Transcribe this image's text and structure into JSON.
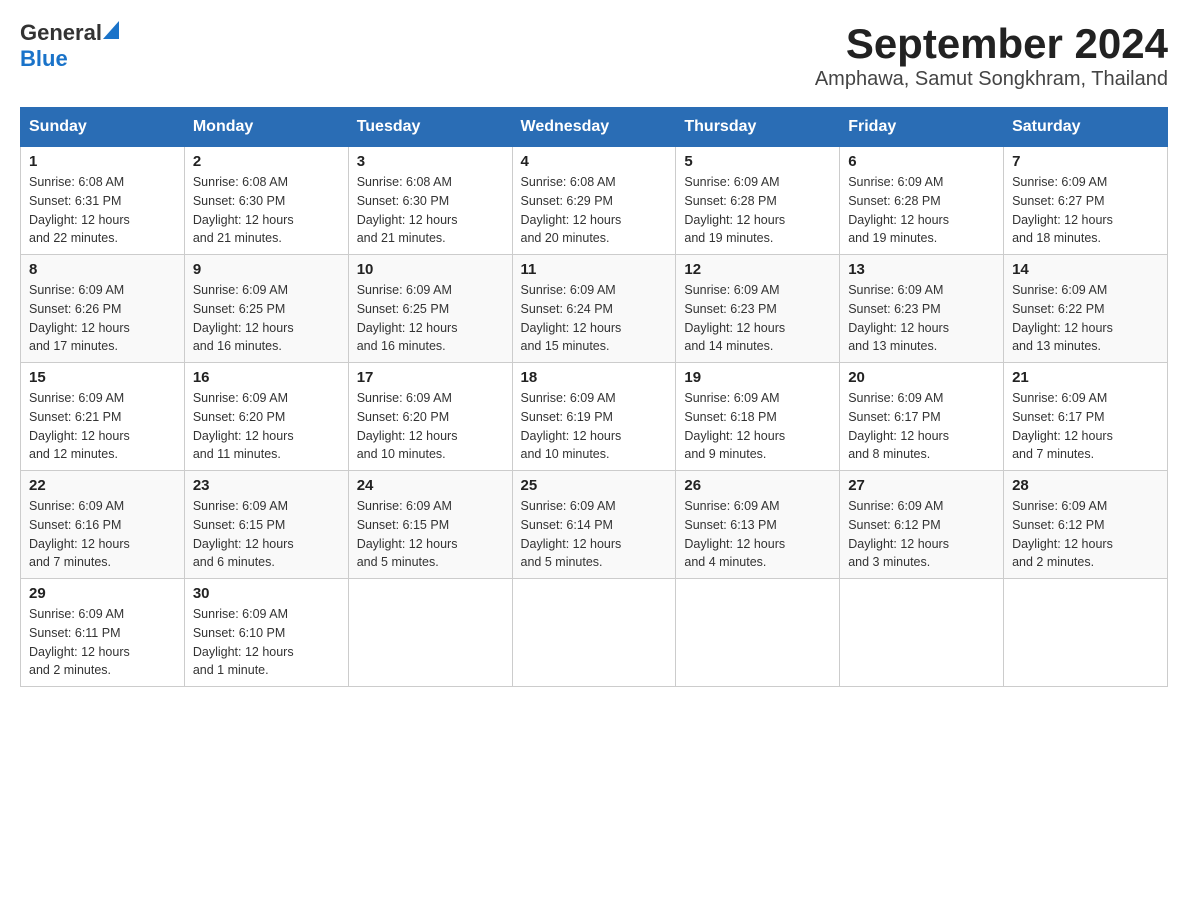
{
  "header": {
    "logo_general": "General",
    "logo_blue": "Blue",
    "month_year": "September 2024",
    "location": "Amphawa, Samut Songkhram, Thailand"
  },
  "weekdays": [
    "Sunday",
    "Monday",
    "Tuesday",
    "Wednesday",
    "Thursday",
    "Friday",
    "Saturday"
  ],
  "weeks": [
    [
      {
        "day": "1",
        "sunrise": "6:08 AM",
        "sunset": "6:31 PM",
        "daylight": "12 hours and 22 minutes."
      },
      {
        "day": "2",
        "sunrise": "6:08 AM",
        "sunset": "6:30 PM",
        "daylight": "12 hours and 21 minutes."
      },
      {
        "day": "3",
        "sunrise": "6:08 AM",
        "sunset": "6:30 PM",
        "daylight": "12 hours and 21 minutes."
      },
      {
        "day": "4",
        "sunrise": "6:08 AM",
        "sunset": "6:29 PM",
        "daylight": "12 hours and 20 minutes."
      },
      {
        "day": "5",
        "sunrise": "6:09 AM",
        "sunset": "6:28 PM",
        "daylight": "12 hours and 19 minutes."
      },
      {
        "day": "6",
        "sunrise": "6:09 AM",
        "sunset": "6:28 PM",
        "daylight": "12 hours and 19 minutes."
      },
      {
        "day": "7",
        "sunrise": "6:09 AM",
        "sunset": "6:27 PM",
        "daylight": "12 hours and 18 minutes."
      }
    ],
    [
      {
        "day": "8",
        "sunrise": "6:09 AM",
        "sunset": "6:26 PM",
        "daylight": "12 hours and 17 minutes."
      },
      {
        "day": "9",
        "sunrise": "6:09 AM",
        "sunset": "6:25 PM",
        "daylight": "12 hours and 16 minutes."
      },
      {
        "day": "10",
        "sunrise": "6:09 AM",
        "sunset": "6:25 PM",
        "daylight": "12 hours and 16 minutes."
      },
      {
        "day": "11",
        "sunrise": "6:09 AM",
        "sunset": "6:24 PM",
        "daylight": "12 hours and 15 minutes."
      },
      {
        "day": "12",
        "sunrise": "6:09 AM",
        "sunset": "6:23 PM",
        "daylight": "12 hours and 14 minutes."
      },
      {
        "day": "13",
        "sunrise": "6:09 AM",
        "sunset": "6:23 PM",
        "daylight": "12 hours and 13 minutes."
      },
      {
        "day": "14",
        "sunrise": "6:09 AM",
        "sunset": "6:22 PM",
        "daylight": "12 hours and 13 minutes."
      }
    ],
    [
      {
        "day": "15",
        "sunrise": "6:09 AM",
        "sunset": "6:21 PM",
        "daylight": "12 hours and 12 minutes."
      },
      {
        "day": "16",
        "sunrise": "6:09 AM",
        "sunset": "6:20 PM",
        "daylight": "12 hours and 11 minutes."
      },
      {
        "day": "17",
        "sunrise": "6:09 AM",
        "sunset": "6:20 PM",
        "daylight": "12 hours and 10 minutes."
      },
      {
        "day": "18",
        "sunrise": "6:09 AM",
        "sunset": "6:19 PM",
        "daylight": "12 hours and 10 minutes."
      },
      {
        "day": "19",
        "sunrise": "6:09 AM",
        "sunset": "6:18 PM",
        "daylight": "12 hours and 9 minutes."
      },
      {
        "day": "20",
        "sunrise": "6:09 AM",
        "sunset": "6:17 PM",
        "daylight": "12 hours and 8 minutes."
      },
      {
        "day": "21",
        "sunrise": "6:09 AM",
        "sunset": "6:17 PM",
        "daylight": "12 hours and 7 minutes."
      }
    ],
    [
      {
        "day": "22",
        "sunrise": "6:09 AM",
        "sunset": "6:16 PM",
        "daylight": "12 hours and 7 minutes."
      },
      {
        "day": "23",
        "sunrise": "6:09 AM",
        "sunset": "6:15 PM",
        "daylight": "12 hours and 6 minutes."
      },
      {
        "day": "24",
        "sunrise": "6:09 AM",
        "sunset": "6:15 PM",
        "daylight": "12 hours and 5 minutes."
      },
      {
        "day": "25",
        "sunrise": "6:09 AM",
        "sunset": "6:14 PM",
        "daylight": "12 hours and 5 minutes."
      },
      {
        "day": "26",
        "sunrise": "6:09 AM",
        "sunset": "6:13 PM",
        "daylight": "12 hours and 4 minutes."
      },
      {
        "day": "27",
        "sunrise": "6:09 AM",
        "sunset": "6:12 PM",
        "daylight": "12 hours and 3 minutes."
      },
      {
        "day": "28",
        "sunrise": "6:09 AM",
        "sunset": "6:12 PM",
        "daylight": "12 hours and 2 minutes."
      }
    ],
    [
      {
        "day": "29",
        "sunrise": "6:09 AM",
        "sunset": "6:11 PM",
        "daylight": "12 hours and 2 minutes."
      },
      {
        "day": "30",
        "sunrise": "6:09 AM",
        "sunset": "6:10 PM",
        "daylight": "12 hours and 1 minute."
      },
      null,
      null,
      null,
      null,
      null
    ]
  ],
  "sunrise_label": "Sunrise:",
  "sunset_label": "Sunset:",
  "daylight_label": "Daylight:"
}
